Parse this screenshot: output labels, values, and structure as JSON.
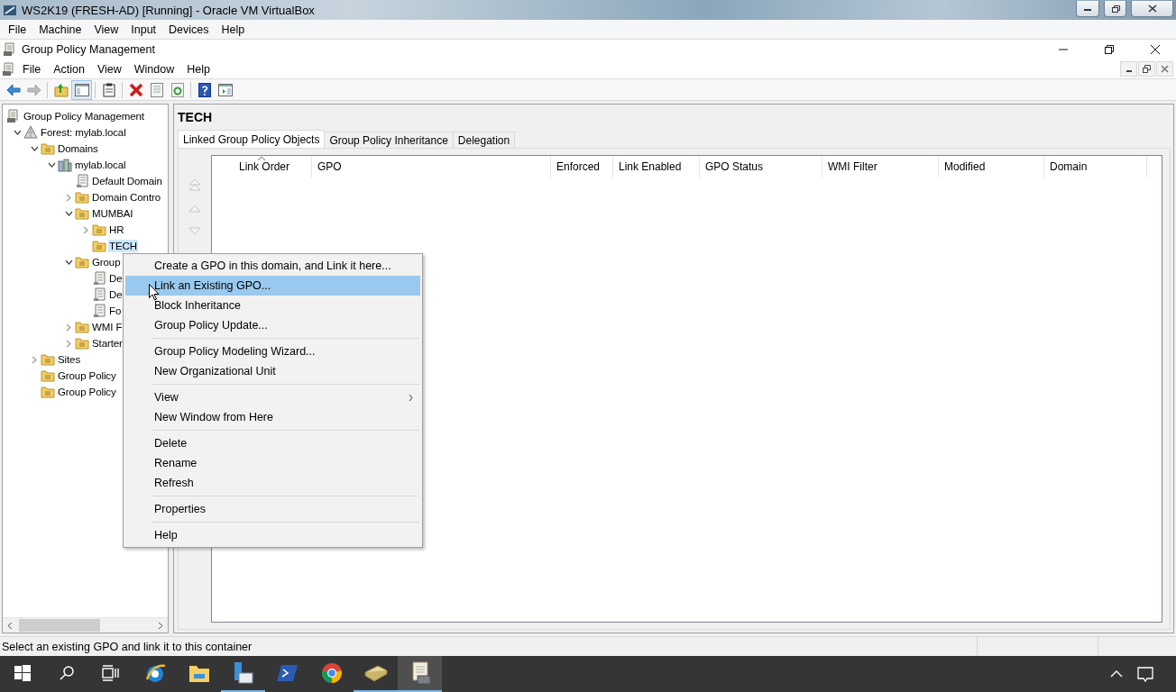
{
  "vm_window": {
    "title": "WS2K19 (FRESH-AD) [Running] - Oracle VM VirtualBox",
    "menu": [
      "File",
      "Machine",
      "View",
      "Input",
      "Devices",
      "Help"
    ]
  },
  "app_window": {
    "title": "Group Policy Management",
    "menu": [
      "File",
      "Action",
      "View",
      "Window",
      "Help"
    ]
  },
  "toolbar": [
    [
      {
        "kind": "back",
        "disabled": false,
        "pressed": false
      },
      {
        "kind": "forward",
        "disabled": true,
        "pressed": false
      }
    ],
    [
      {
        "kind": "up-folder",
        "disabled": false,
        "pressed": false
      },
      {
        "kind": "console-tree",
        "disabled": false,
        "pressed": true
      }
    ],
    [
      {
        "kind": "clipboard",
        "disabled": false,
        "pressed": false
      }
    ],
    [
      {
        "kind": "delete",
        "disabled": false,
        "pressed": false
      },
      {
        "kind": "properties",
        "disabled": false,
        "pressed": false
      },
      {
        "kind": "refresh",
        "disabled": false,
        "pressed": false
      }
    ],
    [
      {
        "kind": "help",
        "disabled": false,
        "pressed": false
      },
      {
        "kind": "action-pane",
        "disabled": false,
        "pressed": false
      }
    ]
  ],
  "tree": [
    {
      "label": "Group Policy Management",
      "kind": "console",
      "selected": false,
      "children": [
        {
          "label": "Forest: mylab.local",
          "kind": "pyramid",
          "expanded": true,
          "selected": false,
          "children": [
            {
              "label": "Domains",
              "kind": "folder",
              "expanded": true,
              "selected": false,
              "children": [
                {
                  "label": "mylab.local",
                  "kind": "servers",
                  "expanded": true,
                  "selected": false,
                  "children": [
                    {
                      "label": "Default Domain",
                      "kind": "scroll",
                      "selected": false
                    },
                    {
                      "label": "Domain Contro",
                      "kind": "folder",
                      "expanded": false,
                      "selected": false
                    },
                    {
                      "label": "MUMBAI",
                      "kind": "folder",
                      "expanded": true,
                      "selected": false,
                      "children": [
                        {
                          "label": "HR",
                          "kind": "folder",
                          "expanded": false,
                          "selected": false
                        },
                        {
                          "label": "TECH",
                          "kind": "folder",
                          "selected": true
                        }
                      ]
                    },
                    {
                      "label": "Group",
                      "kind": "folder",
                      "expanded": true,
                      "selected": false,
                      "children": [
                        {
                          "label": "De",
                          "kind": "scroll",
                          "selected": false
                        },
                        {
                          "label": "De",
                          "kind": "scroll",
                          "selected": false
                        },
                        {
                          "label": "Fo",
                          "kind": "scroll",
                          "selected": false
                        }
                      ]
                    },
                    {
                      "label": "WMI F",
                      "kind": "folder",
                      "expanded": false,
                      "selected": false
                    },
                    {
                      "label": "Starter",
                      "kind": "folder",
                      "expanded": false,
                      "selected": false
                    }
                  ]
                }
              ]
            },
            {
              "label": "Sites",
              "kind": "folder",
              "expanded": false,
              "selected": false
            },
            {
              "label": "Group Policy",
              "kind": "folder",
              "selected": false
            },
            {
              "label": "Group Policy",
              "kind": "folder",
              "selected": false
            }
          ]
        }
      ]
    }
  ],
  "details": {
    "heading": "TECH",
    "tabs": [
      {
        "label": "Linked Group Policy Objects",
        "selected": true
      },
      {
        "label": "Group Policy Inheritance",
        "selected": false
      },
      {
        "label": "Delegation",
        "selected": false
      }
    ],
    "order_buttons": [
      {
        "kind": "top",
        "disabled": true
      },
      {
        "kind": "up",
        "disabled": true
      },
      {
        "kind": "down",
        "disabled": true
      }
    ],
    "columns": [
      {
        "label": "Link Order",
        "sorted": true
      },
      {
        "label": "GPO",
        "sorted": false
      },
      {
        "label": "Enforced",
        "sorted": false
      },
      {
        "label": "Link Enabled",
        "sorted": false
      },
      {
        "label": "GPO Status",
        "sorted": false
      },
      {
        "label": "WMI Filter",
        "sorted": false
      },
      {
        "label": "Modified",
        "sorted": false
      },
      {
        "label": "Domain",
        "sorted": false
      }
    ]
  },
  "context_menu": {
    "groups": [
      [
        {
          "label": "Create a GPO in this domain, and Link it here...",
          "selected": false,
          "submenu": false
        },
        {
          "label": "Link an Existing GPO...",
          "selected": true,
          "submenu": false
        },
        {
          "label": "Block Inheritance",
          "selected": false,
          "submenu": false
        },
        {
          "label": "Group Policy Update...",
          "selected": false,
          "submenu": false
        }
      ],
      [
        {
          "label": "Group Policy Modeling Wizard...",
          "selected": false,
          "submenu": false
        },
        {
          "label": "New Organizational Unit",
          "selected": false,
          "submenu": false
        }
      ],
      [
        {
          "label": "View",
          "selected": false,
          "submenu": true
        },
        {
          "label": "New Window from Here",
          "selected": false,
          "submenu": false
        }
      ],
      [
        {
          "label": "Delete",
          "selected": false,
          "submenu": false
        },
        {
          "label": "Rename",
          "selected": false,
          "submenu": false
        },
        {
          "label": "Refresh",
          "selected": false,
          "submenu": false
        }
      ],
      [
        {
          "label": "Properties",
          "selected": false,
          "submenu": false
        }
      ],
      [
        {
          "label": "Help",
          "selected": false,
          "submenu": false
        }
      ]
    ]
  },
  "status_bar": {
    "text": "Select an existing GPO and link it to this container"
  },
  "taskbar": {
    "apps": [
      {
        "kind": "start",
        "running": false,
        "selected": false
      },
      {
        "kind": "search",
        "running": false,
        "selected": false
      },
      {
        "kind": "task-view",
        "running": false,
        "selected": false
      },
      {
        "kind": "browser",
        "running": false,
        "selected": false
      },
      {
        "kind": "files",
        "running": false,
        "selected": false
      },
      {
        "kind": "server",
        "running": true,
        "selected": false
      },
      {
        "kind": "shell",
        "running": false,
        "selected": false
      },
      {
        "kind": "round-logo",
        "running": false,
        "selected": false
      },
      {
        "kind": "package",
        "running": true,
        "selected": false
      },
      {
        "kind": "console",
        "running": true,
        "selected": true
      }
    ]
  }
}
